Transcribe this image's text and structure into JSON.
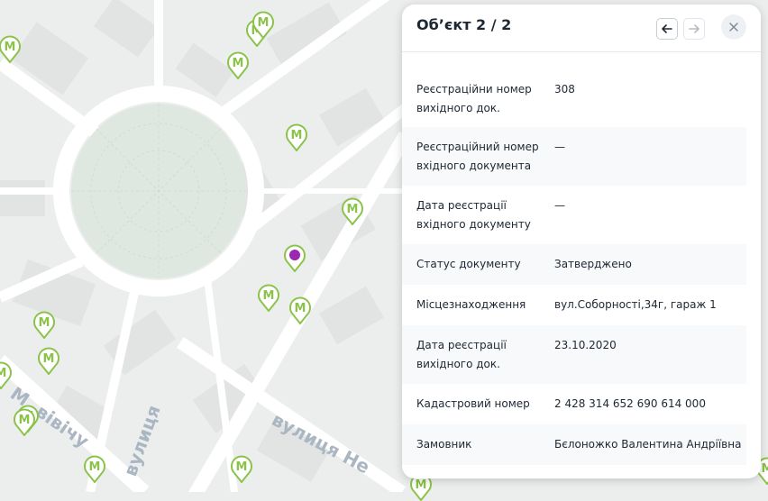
{
  "panel": {
    "title": "Об’єкт 2 / 2",
    "prev_icon": "arrow-left-icon",
    "next_icon": "arrow-right-icon",
    "close_icon": "close-icon",
    "rows": [
      {
        "label": "Реєстраційни номер вихідного док.",
        "value": "308"
      },
      {
        "label": "Реєстраційний номер вхідного документа",
        "value": "—"
      },
      {
        "label": "Дата реєстрації вхідного документу",
        "value": "—"
      },
      {
        "label": "Статус документу",
        "value": "Затверджено"
      },
      {
        "label": "Місцезнаходження",
        "value": "вул.Соборності,34г, гараж 1"
      },
      {
        "label": "Дата реєстрації вихідного док.",
        "value": "23.10.2020"
      },
      {
        "label": "Кадастровий номер",
        "value": "2 428 314 652 690 614 000"
      },
      {
        "label": "Замовник",
        "value": "Бєлоножко Валентина Андріївна"
      }
    ]
  },
  "map": {
    "street_labels": [
      "вулиця Не",
      "М. вівічу",
      "вулиця"
    ],
    "marker_glyph": "М",
    "marker_color": "#8bc34a",
    "selected_color": "#9c27b0"
  }
}
